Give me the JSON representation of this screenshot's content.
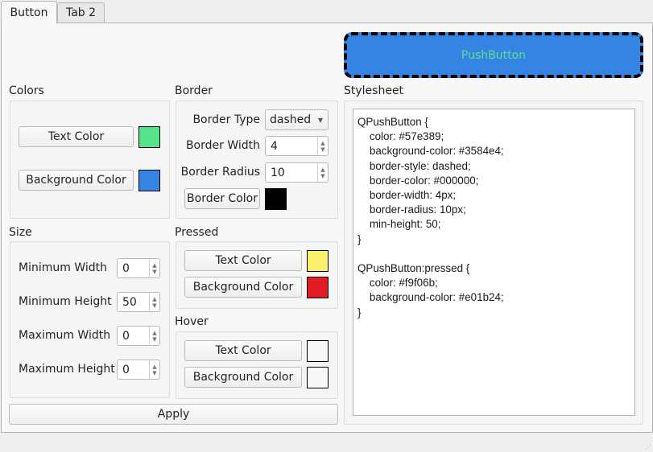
{
  "tabs": [
    {
      "label": "Button",
      "active": true
    },
    {
      "label": "Tab 2",
      "active": false
    }
  ],
  "preview_button": {
    "label": "PushButton",
    "text_color": "#57e389",
    "background_color": "#3584e4",
    "border_color": "#000000",
    "border_style": "dashed"
  },
  "colors": {
    "title": "Colors",
    "text_color_label": "Text Color",
    "text_color": "#57e389",
    "background_color_label": "Background Color",
    "background_color": "#3584e4"
  },
  "border": {
    "title": "Border",
    "type_label": "Border Type",
    "type_value": "dashed",
    "width_label": "Border Width",
    "width_value": "4",
    "radius_label": "Border Radius",
    "radius_value": "10",
    "color_label": "Border Color",
    "color": "#000000"
  },
  "size": {
    "title": "Size",
    "fields": [
      {
        "label": "Minimum Width",
        "value": "0"
      },
      {
        "label": "Minimum Height",
        "value": "50"
      },
      {
        "label": "Maximum Width",
        "value": "0"
      },
      {
        "label": "Maximum Height",
        "value": "0"
      }
    ]
  },
  "pressed": {
    "title": "Pressed",
    "text_color_label": "Text Color",
    "text_color": "#f9f06b",
    "background_color_label": "Background Color",
    "background_color": "#e01b24"
  },
  "hover": {
    "title": "Hover",
    "text_color_label": "Text Color",
    "text_color": "#f8f8f8",
    "background_color_label": "Background Color",
    "background_color": "#f8f8f8"
  },
  "apply_label": "Apply",
  "stylesheet": {
    "title": "Stylesheet",
    "text": "QPushButton {\n    color: #57e389;\n    background-color: #3584e4;\n    border-style: dashed;\n    border-color: #000000;\n    border-width: 4px;\n    border-radius: 10px;\n    min-height: 50;\n}\n\nQPushButton:pressed {\n    color: #f9f06b;\n    background-color: #e01b24;\n}"
  }
}
